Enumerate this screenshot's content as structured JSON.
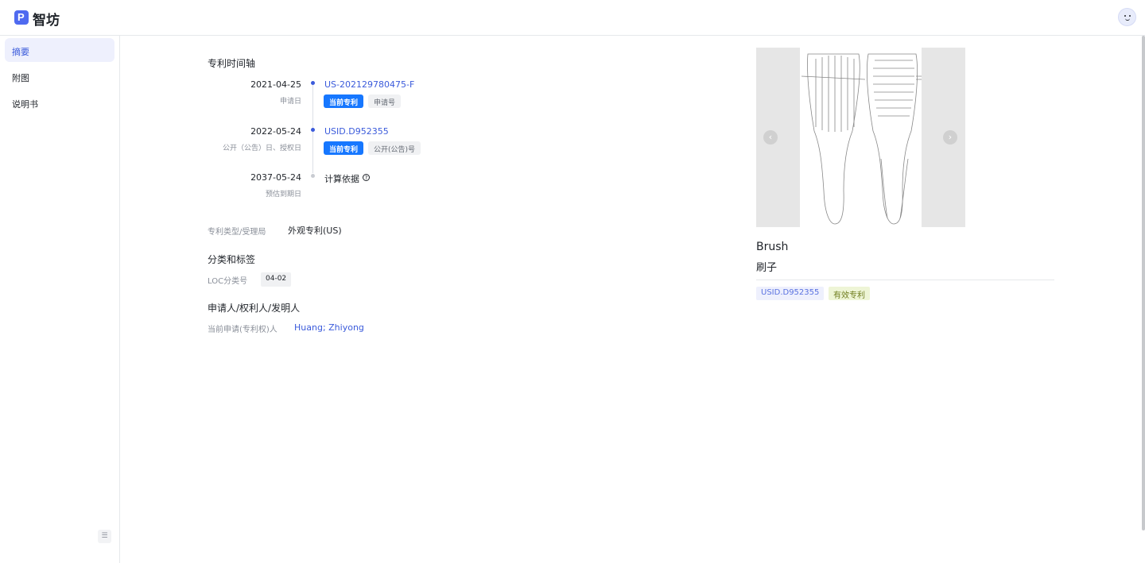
{
  "app": {
    "brand": "智坊",
    "logo_letter": "P"
  },
  "sidebar": {
    "items": [
      {
        "label": "摘要"
      },
      {
        "label": "附图"
      },
      {
        "label": "说明书"
      }
    ],
    "collapse_icon": "menu-fold-icon"
  },
  "timeline": {
    "title": "专利时间轴",
    "events": [
      {
        "date": "2021-04-25",
        "sub": "申请日",
        "link": "US-202129780475-F",
        "tags": [
          "当前专利",
          "申请号"
        ]
      },
      {
        "date": "2022-05-24",
        "sub": "公开（公告）日、授权日",
        "link": "USID.D952355",
        "tags": [
          "当前专利",
          "公开(公告)号"
        ]
      },
      {
        "date": "2037-05-24",
        "sub": "预估到期日",
        "text": "计算依据",
        "help_icon": "question-circle-icon"
      }
    ]
  },
  "patent_type": {
    "label": "专利类型/受理局",
    "value": "外观专利(US)"
  },
  "classification": {
    "title": "分类和标签",
    "loc_label": "LOC分类号",
    "loc_value": "04-02"
  },
  "parties": {
    "title": "申请人/权利人/发明人",
    "label": "当前申请(专利权)人",
    "value": "Huang; Zhiyong"
  },
  "product": {
    "name_en": "Brush",
    "name_cn": "刷子",
    "number": "USID.D952355",
    "status": "有效专利"
  },
  "colors": {
    "accent": "#3b5bdb",
    "tag_blue": "#1677ff"
  }
}
